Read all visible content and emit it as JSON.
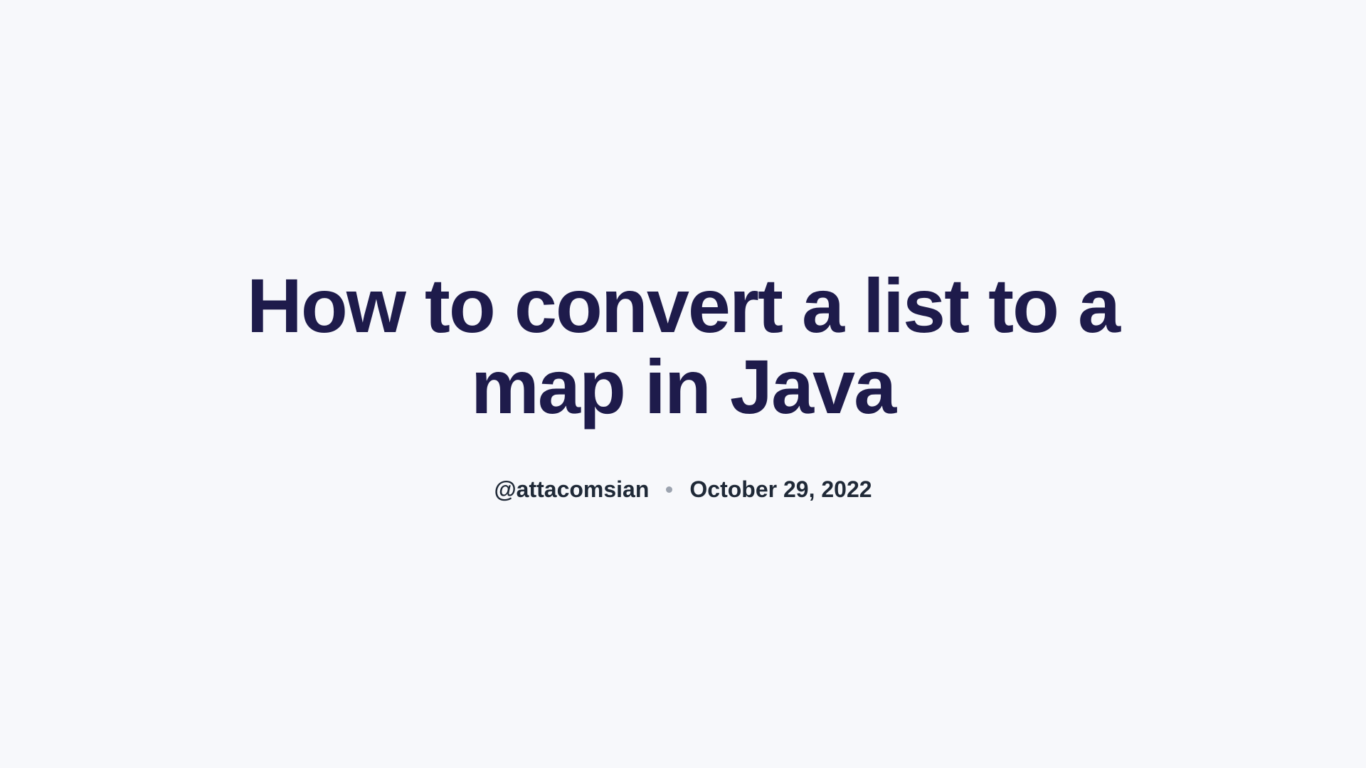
{
  "title": "How to convert a list to a map in Java",
  "author": "@attacomsian",
  "date": "October 29, 2022"
}
